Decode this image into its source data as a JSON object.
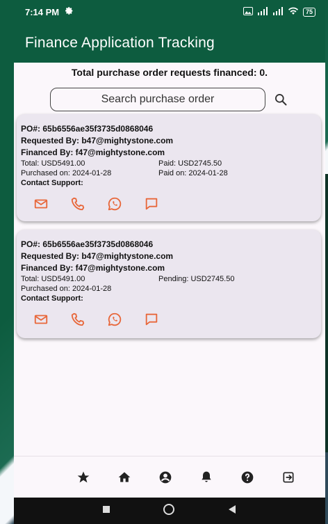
{
  "status_bar": {
    "time": "7:14 PM",
    "battery": "75"
  },
  "app_bar": {
    "title": "Finance Application Tracking"
  },
  "summary": "Total purchase order requests financed: 0.",
  "search": {
    "placeholder": "Search purchase order"
  },
  "orders": [
    {
      "po": "PO#: 65b6556ae35f3735d0868046",
      "requested_by": "Requested By: b47@mightystone.com",
      "financed_by": "Financed By: f47@mightystone.com",
      "total": "Total: USD5491.00",
      "amount_status": "Paid: USD2745.50",
      "purchased_on": "Purchased on: 2024-01-28",
      "paid_on": "Paid on: 2024-01-28",
      "contact_label": "Contact Support:"
    },
    {
      "po": "PO#: 65b6556ae35f3735d0868046",
      "requested_by": "Requested By: b47@mightystone.com",
      "financed_by": "Financed By: f47@mightystone.com",
      "total": "Total: USD5491.00",
      "amount_status": "Pending: USD2745.50",
      "purchased_on": "Purchased on: 2024-01-28",
      "paid_on": "",
      "contact_label": "Contact Support:"
    }
  ],
  "contact_icons": [
    "email-icon",
    "phone-icon",
    "whatsapp-icon",
    "chat-icon"
  ],
  "bottom_nav": [
    "star-icon",
    "home-icon",
    "account-icon",
    "bell-icon",
    "help-icon",
    "logout-icon"
  ],
  "colors": {
    "primary": "#0d5c3f",
    "accent": "#e8673a",
    "card": "#ebe6ef"
  }
}
